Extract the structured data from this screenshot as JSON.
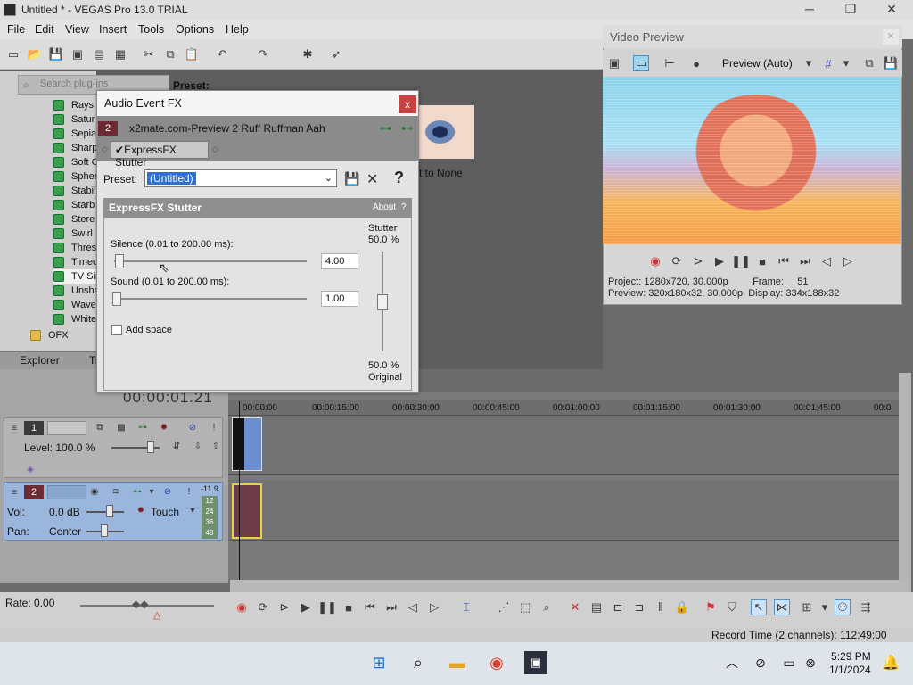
{
  "window": {
    "title": "Untitled * - VEGAS Pro 13.0 TRIAL",
    "min": "─",
    "max": "❐",
    "close": "✕"
  },
  "menu": [
    "File",
    "Edit",
    "View",
    "Insert",
    "Tools",
    "Options",
    "Help"
  ],
  "explorer": {
    "search_placeholder": "Search plug-ins",
    "plugins": [
      "Rays",
      "Satur",
      "Sepia",
      "Sharp",
      "Soft C",
      "Spher",
      "Stabil",
      "Starb",
      "Stere",
      "Swirl",
      "Thres",
      "Timec",
      "TV Sir",
      "Unsha",
      "Wave",
      "White"
    ],
    "folder": "OFX",
    "tabs": [
      "Explorer",
      "Tr"
    ],
    "preset_label": "Preset:",
    "reset_to_none": "t to None"
  },
  "preview": {
    "title": "Video Preview",
    "mode": "Preview (Auto)",
    "project_label": "Project:",
    "project_value": "1280x720, 30.000p",
    "frame_label": "Frame:",
    "frame_value": "51",
    "preview_label": "Preview:",
    "preview_value": "320x180x32, 30.000p",
    "display_label": "Display:",
    "display_value": "334x188x32"
  },
  "timeline": {
    "timecode": "00:00:01.21",
    "ruler": [
      "00:00:00",
      "00:00:15:00",
      "00:00:30:00",
      "00:00:45:00",
      "00:01:00:00",
      "00:01:15:00",
      "00:01:30:00",
      "00:01:45:00",
      "00:0"
    ],
    "track1": {
      "num": "1",
      "level": "Level: 100.0 %"
    },
    "track2": {
      "num": "2",
      "vol_label": "Vol:",
      "vol_value": "0.0 dB",
      "pan_label": "Pan:",
      "pan_value": "Center",
      "touch": "Touch",
      "meter_top": "-11.9",
      "meter_marks": [
        "12",
        "24",
        "36",
        "48"
      ]
    },
    "rate": "Rate: 0.00",
    "record_time": "Record Time (2 channels): 112:49:00"
  },
  "dialog": {
    "title": "Audio Event FX",
    "close": "x",
    "event_num": "2",
    "event_name": "x2mate.com-Preview 2 Ruff Ruffman Aah",
    "fx_chip": "ExpressFX Stutter",
    "preset_label": "Preset:",
    "preset_value": "(Untitled)",
    "help": "?",
    "panel_title": "ExpressFX Stutter",
    "about": "About",
    "silence_label": "Silence (0.01 to 200.00 ms):",
    "silence_value": "4.00",
    "sound_label": "Sound (0.01 to 200.00 ms):",
    "sound_value": "1.00",
    "add_space": "Add space",
    "stutter_label": "Stutter",
    "stutter_top": "50.0 %",
    "stutter_bottom": "50.0 %",
    "original_label": "Original"
  },
  "taskbar": {
    "time": "5:29 PM",
    "date": "1/1/2024"
  }
}
